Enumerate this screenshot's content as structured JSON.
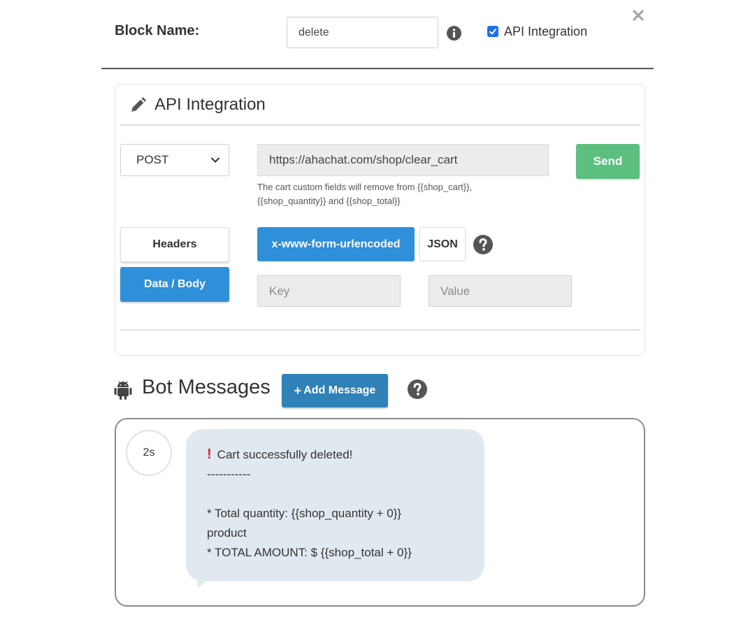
{
  "header": {
    "block_name_label": "Block Name:",
    "block_name_value": "delete",
    "api_integration_checkbox_label": "API Integration",
    "api_integration_checked": true
  },
  "api_panel": {
    "title": "API Integration",
    "method": "POST",
    "url": "https://ahachat.com/shop/clear_cart",
    "help_text_line1": "The cart custom fields will remove from {{shop_cart}},",
    "help_text_line2": "{{shop_quantity}} and {{shop_total}}",
    "send_label": "Send",
    "headers_label": "Headers",
    "data_body_label": "Data / Body",
    "encoding_urlencoded_label": "x-www-form-urlencoded",
    "encoding_json_label": "JSON",
    "key_placeholder": "Key",
    "value_placeholder": "Value"
  },
  "bot_messages": {
    "title": "Bot Messages",
    "add_message_label": "Add Message",
    "delay": "2s",
    "message_lines": [
      "Cart successfully deleted!",
      "-----------",
      "",
      "* Total quantity: {{shop_quantity + 0}}",
      "product",
      "* TOTAL AMOUNT: $ {{shop_total + 0}}"
    ]
  },
  "colors": {
    "primary_blue": "#2f8fd8",
    "send_green": "#5cbf7f",
    "bubble_bg": "#e1e9f0",
    "alert_red": "#d9232e"
  }
}
